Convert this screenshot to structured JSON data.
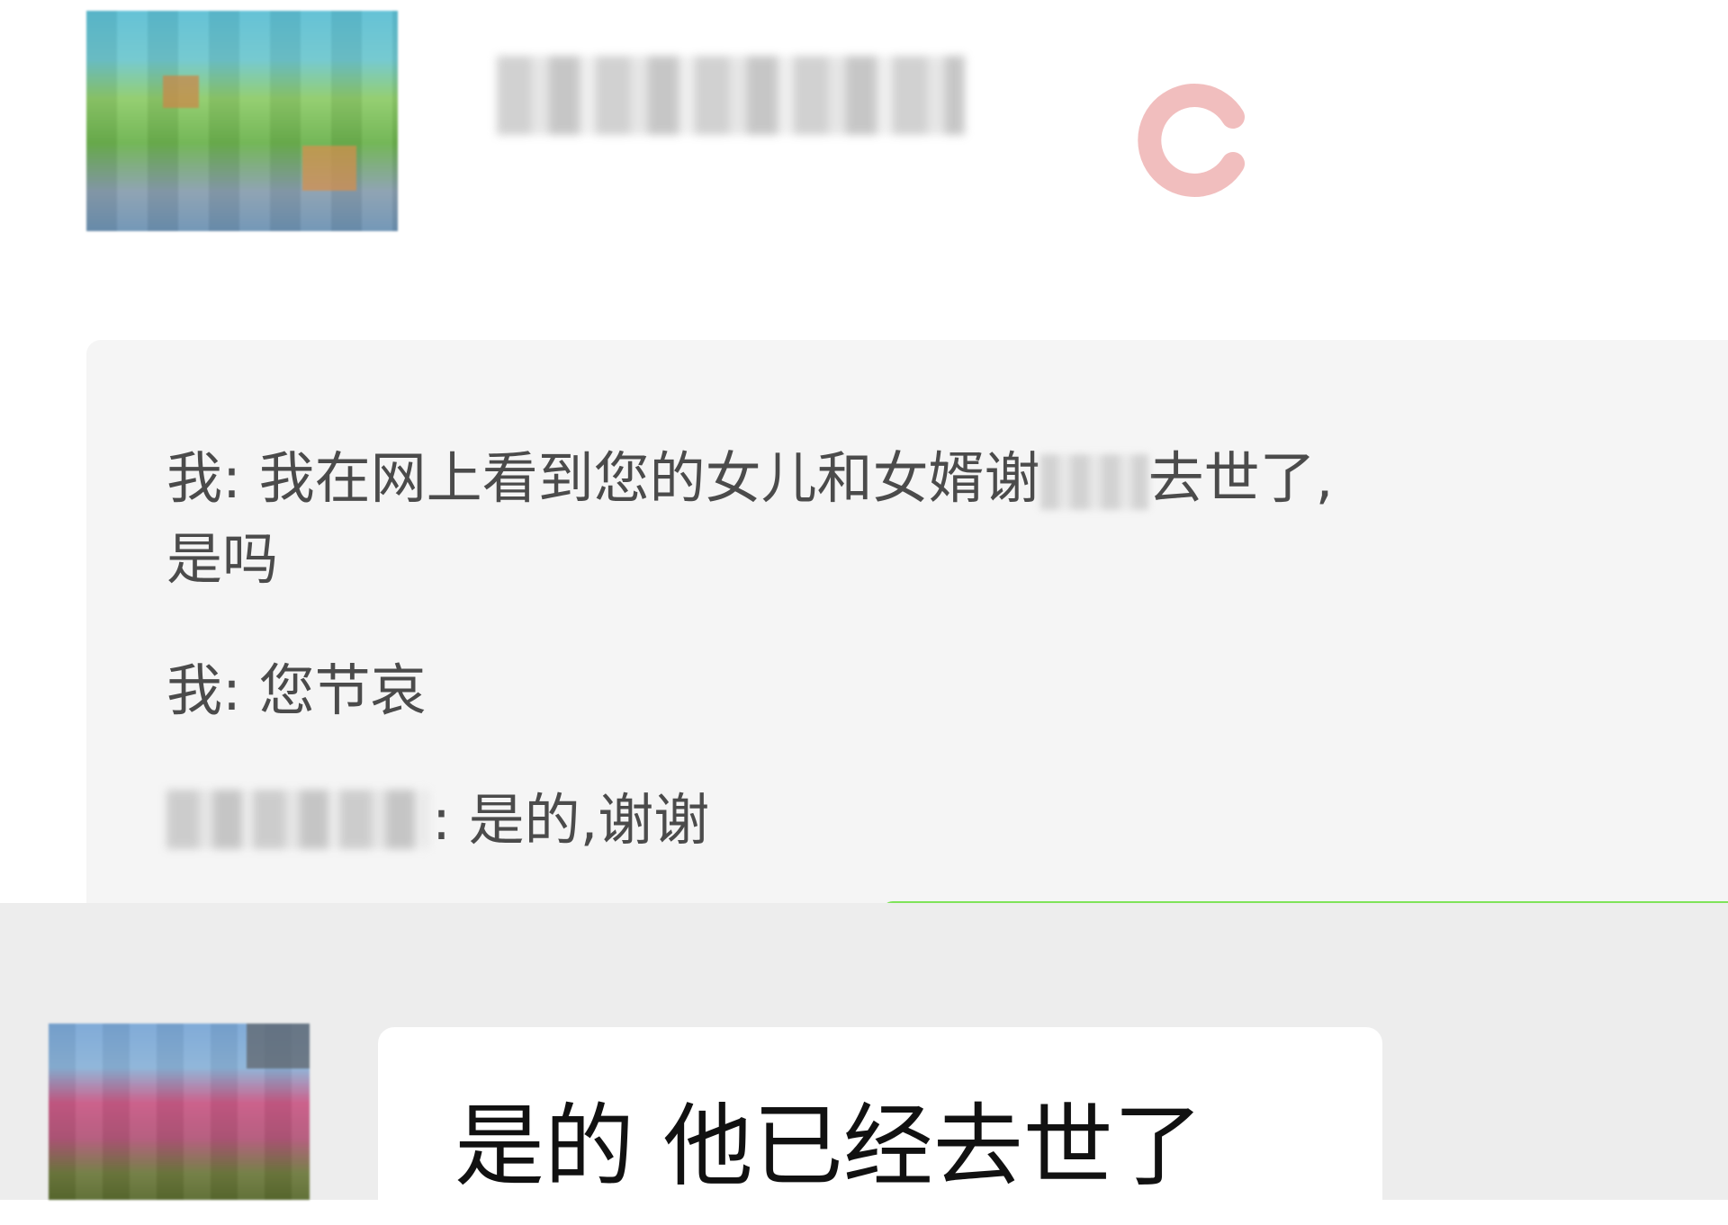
{
  "contact": {
    "name_redacted": true
  },
  "quote": {
    "line1_prefix": "我: 我在网上看到您的女儿和女婿谢",
    "line1_suffix": "去世了,",
    "line2": "是吗",
    "line3": "我: 您节哀",
    "line4_suffix": ": 是的,谢谢"
  },
  "message": {
    "text": "是的 他已经去世了"
  },
  "colors": {
    "accent_green": "#7fe35a",
    "watermark": "#e8a0a0",
    "quote_bg": "#f5f5f5",
    "chat_bg": "#ededed"
  }
}
